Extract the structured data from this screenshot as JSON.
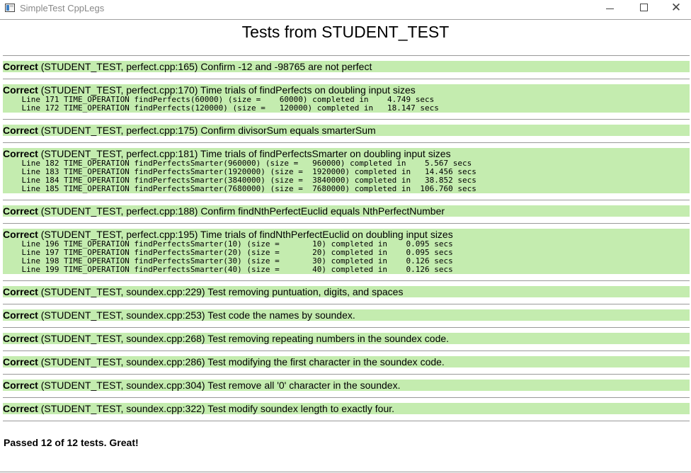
{
  "window": {
    "title": "SimpleTest CppLegs",
    "minimize_icon": "minimize-icon",
    "maximize_icon": "maximize-icon",
    "close_icon": "close-icon"
  },
  "page_title": "Tests from STUDENT_TEST",
  "tests": [
    {
      "status": "Correct",
      "desc": "(STUDENT_TEST, perfect.cpp:165) Confirm -12 and -98765 are not perfect",
      "lines": []
    },
    {
      "status": "Correct",
      "desc": "(STUDENT_TEST, perfect.cpp:170) Time trials of findPerfects on doubling input sizes",
      "lines": [
        "    Line 171 TIME_OPERATION findPerfects(60000) (size =    60000) completed in    4.749 secs",
        "    Line 172 TIME_OPERATION findPerfects(120000) (size =   120000) completed in   18.147 secs"
      ]
    },
    {
      "status": "Correct",
      "desc": "(STUDENT_TEST, perfect.cpp:175) Confirm divisorSum equals smarterSum",
      "lines": []
    },
    {
      "status": "Correct",
      "desc": "(STUDENT_TEST, perfect.cpp:181) Time trials of findPerfectsSmarter on doubling input sizes",
      "lines": [
        "    Line 182 TIME_OPERATION findPerfectsSmarter(960000) (size =   960000) completed in    5.567 secs",
        "    Line 183 TIME_OPERATION findPerfectsSmarter(1920000) (size =  1920000) completed in   14.456 secs",
        "    Line 184 TIME_OPERATION findPerfectsSmarter(3840000) (size =  3840000) completed in   38.852 secs",
        "    Line 185 TIME_OPERATION findPerfectsSmarter(7680000) (size =  7680000) completed in  106.760 secs"
      ]
    },
    {
      "status": "Correct",
      "desc": "(STUDENT_TEST, perfect.cpp:188) Confirm findNthPerfectEuclid equals NthPerfectNumber",
      "lines": []
    },
    {
      "status": "Correct",
      "desc": "(STUDENT_TEST, perfect.cpp:195) Time trials of findNthPerfectEuclid on doubling input sizes",
      "lines": [
        "    Line 196 TIME_OPERATION findPerfectsSmarter(10) (size =       10) completed in    0.095 secs",
        "    Line 197 TIME_OPERATION findPerfectsSmarter(20) (size =       20) completed in    0.095 secs",
        "    Line 198 TIME_OPERATION findPerfectsSmarter(30) (size =       30) completed in    0.126 secs",
        "    Line 199 TIME_OPERATION findPerfectsSmarter(40) (size =       40) completed in    0.126 secs"
      ]
    },
    {
      "status": "Correct",
      "desc": "(STUDENT_TEST, soundex.cpp:229) Test removing puntuation, digits, and spaces",
      "lines": []
    },
    {
      "status": "Correct",
      "desc": "(STUDENT_TEST, soundex.cpp:253) Test code the names by soundex.",
      "lines": []
    },
    {
      "status": "Correct",
      "desc": "(STUDENT_TEST, soundex.cpp:268) Test removing repeating numbers in the soundex code.",
      "lines": []
    },
    {
      "status": "Correct",
      "desc": "(STUDENT_TEST, soundex.cpp:286) Test modifying the first character in the soundex code.",
      "lines": []
    },
    {
      "status": "Correct",
      "desc": "(STUDENT_TEST, soundex.cpp:304) Test remove all '0' character in the soundex.",
      "lines": []
    },
    {
      "status": "Correct",
      "desc": "(STUDENT_TEST, soundex.cpp:322) Test modify soundex length to exactly four.",
      "lines": []
    }
  ],
  "summary": "Passed 12 of 12 tests. Great!",
  "colors": {
    "pass_background": "#c4ecaf",
    "separator": "#999999"
  }
}
